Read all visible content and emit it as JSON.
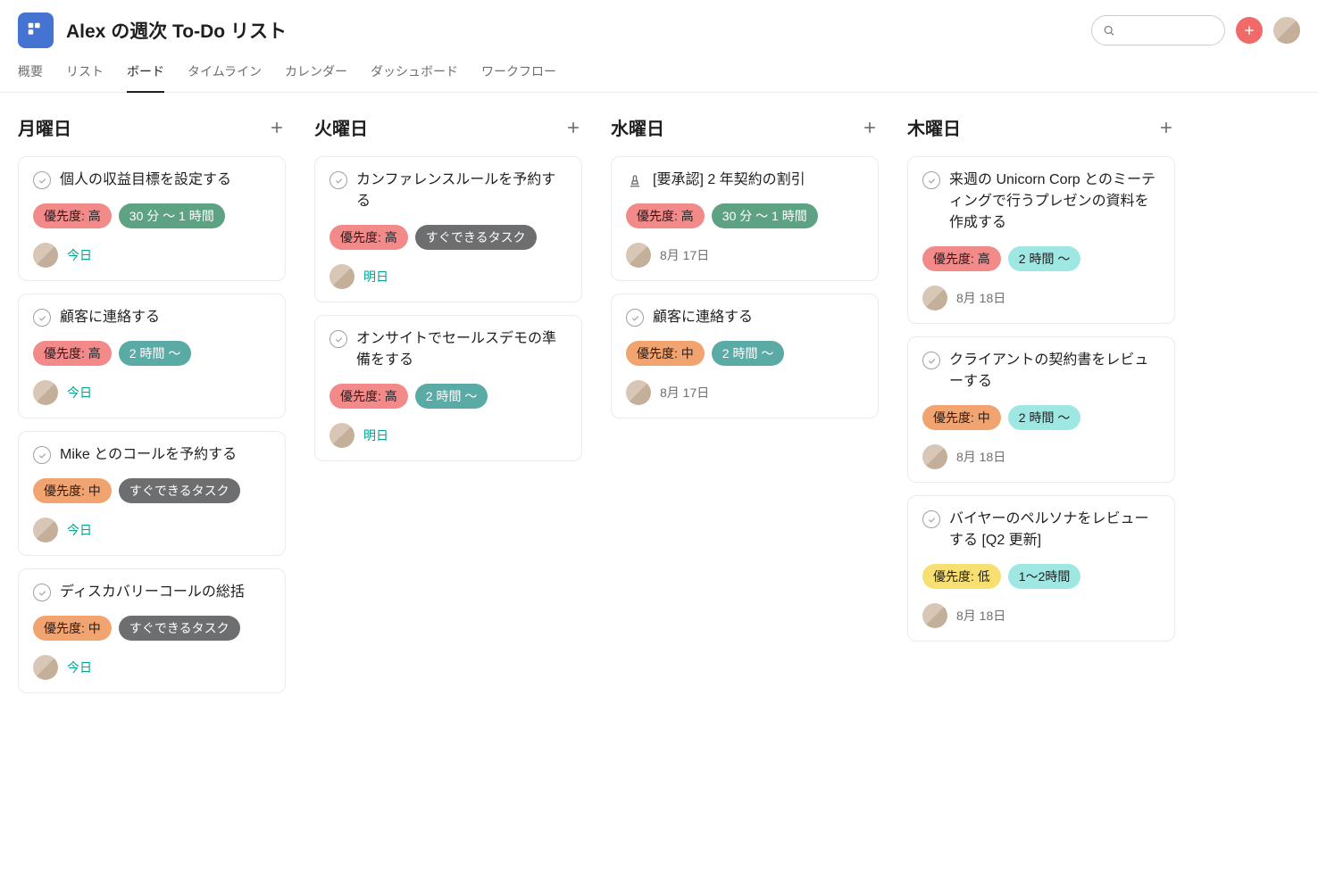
{
  "header": {
    "title": "Alex の週次 To-Do リスト"
  },
  "tabs": [
    "概要",
    "リスト",
    "ボード",
    "タイムライン",
    "カレンダー",
    "ダッシュボード",
    "ワークフロー"
  ],
  "activeTab": 2,
  "columns": [
    {
      "title": "月曜日",
      "cards": [
        {
          "icon": "check",
          "title": "個人の収益目標を設定する",
          "badges": [
            {
              "text": "優先度: 高",
              "cls": "pri-high"
            },
            {
              "text": "30 分 ～ 1 時間",
              "cls": "dur-short"
            }
          ],
          "due": "今日",
          "dueCls": ""
        },
        {
          "icon": "check",
          "title": "顧客に連絡する",
          "badges": [
            {
              "text": "優先度: 高",
              "cls": "pri-high"
            },
            {
              "text": "2 時間 ～",
              "cls": "dur-teal"
            }
          ],
          "due": "今日",
          "dueCls": ""
        },
        {
          "icon": "check",
          "title": "Mike とのコールを予約する",
          "badges": [
            {
              "text": "優先度: 中",
              "cls": "pri-mid"
            },
            {
              "text": "すぐできるタスク",
              "cls": "dur-quick"
            }
          ],
          "due": "今日",
          "dueCls": ""
        },
        {
          "icon": "check",
          "title": "ディスカバリーコールの総括",
          "badges": [
            {
              "text": "優先度: 中",
              "cls": "pri-mid"
            },
            {
              "text": "すぐできるタスク",
              "cls": "dur-quick"
            }
          ],
          "due": "今日",
          "dueCls": ""
        }
      ]
    },
    {
      "title": "火曜日",
      "cards": [
        {
          "icon": "check",
          "title": "カンファレンスルールを予約する",
          "badges": [
            {
              "text": "優先度: 高",
              "cls": "pri-high"
            },
            {
              "text": "すぐできるタスク",
              "cls": "dur-quick"
            }
          ],
          "due": "明日",
          "dueCls": ""
        },
        {
          "icon": "check",
          "title": "オンサイトでセールスデモの準備をする",
          "badges": [
            {
              "text": "優先度: 高",
              "cls": "pri-high"
            },
            {
              "text": "2 時間 ～",
              "cls": "dur-teal"
            }
          ],
          "due": "明日",
          "dueCls": ""
        }
      ]
    },
    {
      "title": "水曜日",
      "cards": [
        {
          "icon": "stamp",
          "title": "[要承認] 2 年契約の割引",
          "badges": [
            {
              "text": "優先度: 高",
              "cls": "pri-high"
            },
            {
              "text": "30 分 ～ 1 時間",
              "cls": "dur-short"
            }
          ],
          "due": "8月 17日",
          "dueCls": "gray"
        },
        {
          "icon": "check",
          "title": "顧客に連絡する",
          "badges": [
            {
              "text": "優先度: 中",
              "cls": "pri-mid"
            },
            {
              "text": "2 時間 ～",
              "cls": "dur-teal"
            }
          ],
          "due": "8月 17日",
          "dueCls": "gray"
        }
      ]
    },
    {
      "title": "木曜日",
      "cards": [
        {
          "icon": "check",
          "title": "来週の Unicorn Corp とのミーティングで行うプレゼンの資料を作成する",
          "badges": [
            {
              "text": "優先度: 高",
              "cls": "pri-high"
            },
            {
              "text": "2 時間 ～",
              "cls": "dur-teal2"
            }
          ],
          "due": "8月 18日",
          "dueCls": "gray"
        },
        {
          "icon": "check",
          "title": "クライアントの契約書をレビューする",
          "badges": [
            {
              "text": "優先度: 中",
              "cls": "pri-mid"
            },
            {
              "text": "2 時間 ～",
              "cls": "dur-teal2"
            }
          ],
          "due": "8月 18日",
          "dueCls": "gray"
        },
        {
          "icon": "check",
          "title": "バイヤーのペルソナをレビューする [Q2 更新]",
          "badges": [
            {
              "text": "優先度: 低",
              "cls": "pri-low"
            },
            {
              "text": "1～2時間",
              "cls": "dur-teal2"
            }
          ],
          "due": "8月 18日",
          "dueCls": "gray"
        }
      ]
    }
  ]
}
